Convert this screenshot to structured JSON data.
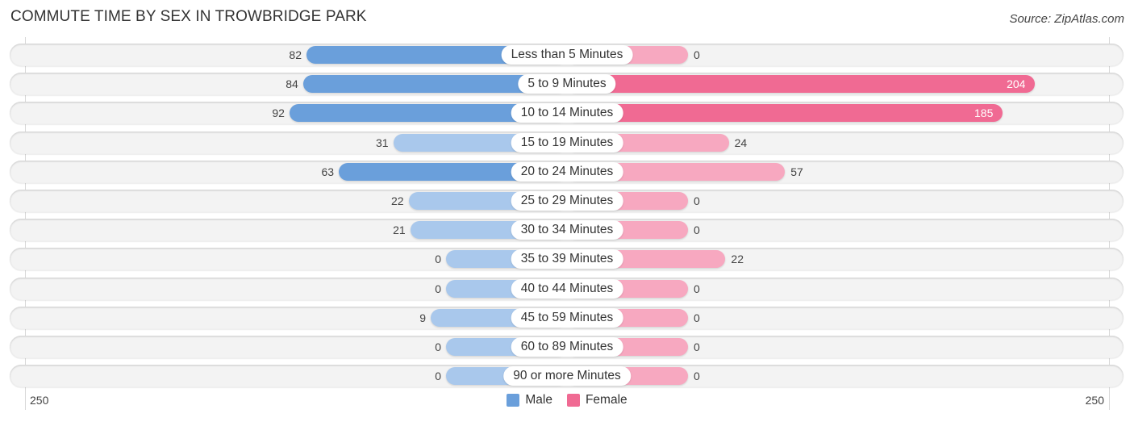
{
  "chart_data": {
    "type": "bar",
    "orientation": "horizontal-diverging",
    "title": "COMMUTE TIME BY SEX IN TROWBRIDGE PARK",
    "source": "Source: ZipAtlas.com",
    "categories": [
      "Less than 5 Minutes",
      "5 to 9 Minutes",
      "10 to 14 Minutes",
      "15 to 19 Minutes",
      "20 to 24 Minutes",
      "25 to 29 Minutes",
      "30 to 34 Minutes",
      "35 to 39 Minutes",
      "40 to 44 Minutes",
      "45 to 59 Minutes",
      "60 to 89 Minutes",
      "90 or more Minutes"
    ],
    "series": [
      {
        "name": "Male",
        "color": "#6a9fdb",
        "light_color": "#a9c8ec",
        "values": [
          82,
          84,
          92,
          31,
          63,
          22,
          21,
          0,
          0,
          9,
          0,
          0
        ]
      },
      {
        "name": "Female",
        "color": "#f06a93",
        "light_color": "#f7a8c0",
        "values": [
          0,
          204,
          185,
          24,
          57,
          0,
          0,
          22,
          0,
          0,
          0,
          0
        ]
      }
    ],
    "axis": {
      "left_tick": "250",
      "right_tick": "250",
      "range": [
        0,
        250
      ]
    },
    "legend": {
      "position": "bottom-center",
      "entries": [
        "Male",
        "Female"
      ]
    }
  }
}
